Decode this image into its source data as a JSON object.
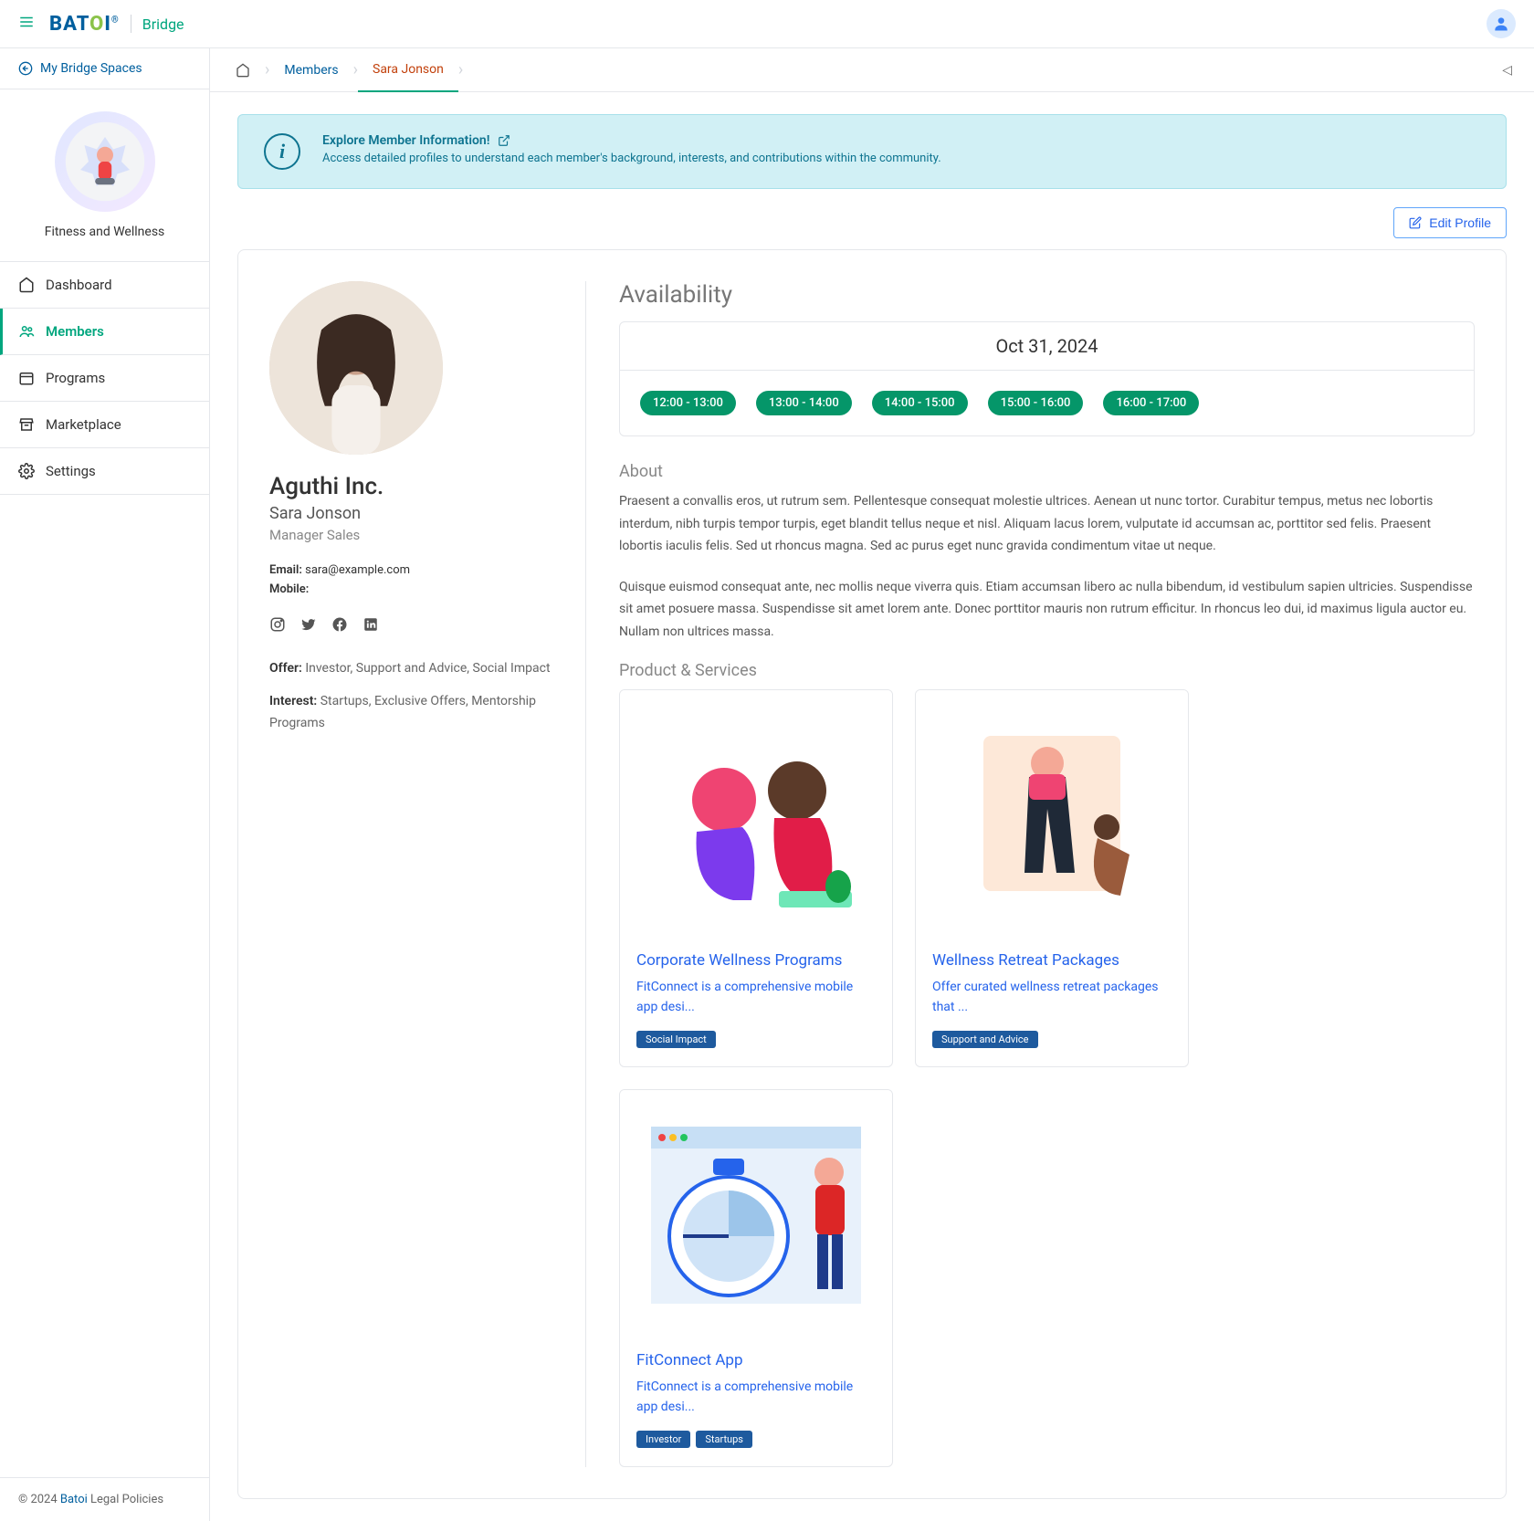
{
  "header": {
    "brand_main": "BAT",
    "brand_o": "O",
    "brand_i": "I",
    "brand_reg": "®",
    "brand_sub": "Bridge"
  },
  "sidebar": {
    "back_label": "My Bridge Spaces",
    "space_name": "Fitness and Wellness",
    "items": [
      {
        "label": "Dashboard"
      },
      {
        "label": "Members"
      },
      {
        "label": "Programs"
      },
      {
        "label": "Marketplace"
      },
      {
        "label": "Settings"
      }
    ]
  },
  "footer": {
    "copyright": "© 2024 ",
    "link1": "Batoi",
    "policies": " Legal Policies"
  },
  "breadcrumb": {
    "members": "Members",
    "current": "Sara  Jonson"
  },
  "banner": {
    "title": "Explore Member Information!",
    "text": "Access detailed profiles to understand each member's background, interests, and contributions within the community."
  },
  "actions": {
    "edit": "Edit Profile"
  },
  "profile": {
    "company": "Aguthi Inc.",
    "name": "Sara Jonson",
    "role": "Manager Sales",
    "email_label": "Email: ",
    "email": "sara@example.com",
    "mobile_label": "Mobile:",
    "mobile": "",
    "offer_label": "Offer: ",
    "offer": "Investor, Support and Advice, Social Impact",
    "interest_label": "Interest: ",
    "interest": "Startups, Exclusive Offers, Mentorship Programs"
  },
  "availability": {
    "heading": "Availability",
    "date": "Oct 31, 2024",
    "slots": [
      "12:00 - 13:00",
      "13:00 - 14:00",
      "14:00 - 15:00",
      "15:00 - 16:00",
      "16:00 - 17:00"
    ]
  },
  "about": {
    "heading": "About",
    "p1": "Praesent a convallis eros, ut rutrum sem. Pellentesque consequat molestie ultrices. Aenean ut nunc tortor. Curabitur tempus, metus nec lobortis interdum, nibh turpis tempor turpis, eget blandit tellus neque et nisl. Aliquam lacus lorem, vulputate id accumsan ac, porttitor sed felis. Praesent lobortis iaculis felis. Sed ut rhoncus magna. Sed ac purus eget nunc gravida condimentum vitae ut neque.",
    "p2": "Quisque euismod consequat ante, nec mollis neque viverra quis. Etiam accumsan libero ac nulla bibendum, id vestibulum sapien ultricies. Suspendisse sit amet posuere massa. Suspendisse sit amet lorem ante. Donec porttitor mauris non rutrum efficitur. In rhoncus leo dui, id maximus ligula auctor eu. Nullam non ultrices massa."
  },
  "products": {
    "heading": "Product & Services",
    "items": [
      {
        "title": "Corporate Wellness Programs",
        "desc": "FitConnect is a comprehensive mobile app desi...",
        "tags": [
          "Social Impact"
        ]
      },
      {
        "title": "Wellness Retreat Packages",
        "desc": "Offer curated wellness retreat packages that ...",
        "tags": [
          "Support and Advice"
        ]
      },
      {
        "title": "FitConnect App",
        "desc": "FitConnect is a comprehensive mobile app desi...",
        "tags": [
          "Investor",
          "Startups"
        ]
      }
    ]
  }
}
